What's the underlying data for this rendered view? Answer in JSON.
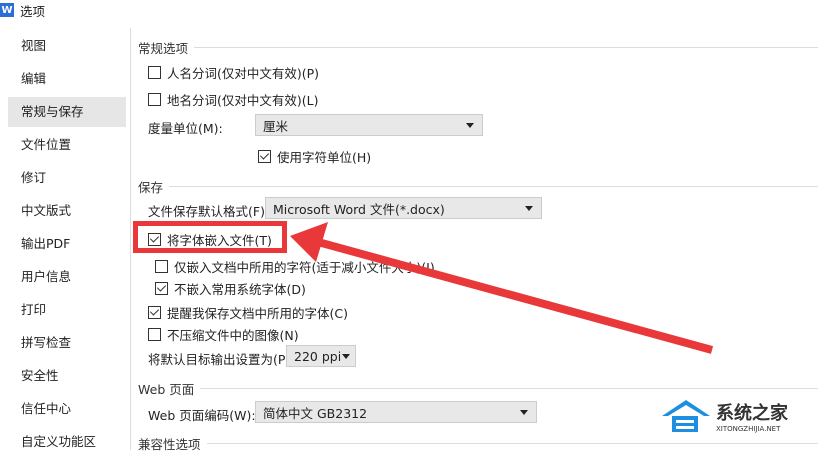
{
  "window": {
    "title": "选项",
    "app_icon": "W"
  },
  "sidebar": {
    "items": [
      {
        "label": "视图"
      },
      {
        "label": "编辑"
      },
      {
        "label": "常规与保存",
        "selected": true
      },
      {
        "label": "文件位置"
      },
      {
        "label": "修订"
      },
      {
        "label": "中文版式"
      },
      {
        "label": "输出PDF"
      },
      {
        "label": "用户信息"
      },
      {
        "label": "打印"
      },
      {
        "label": "拼写检查"
      },
      {
        "label": "安全性"
      },
      {
        "label": "信任中心"
      },
      {
        "label": "自定义功能区"
      }
    ]
  },
  "general": {
    "title": "常规选项",
    "person_name": {
      "label": "人名分词(仅对中文有效)(P)",
      "checked": false
    },
    "place_name": {
      "label": "地名分词(仅对中文有效)(L)",
      "checked": false
    },
    "unit_label": "度量单位(M):",
    "unit_value": "厘米",
    "char_unit": {
      "label": "使用字符单位(H)",
      "checked": true
    }
  },
  "save": {
    "title": "保存",
    "format_label": "文件保存默认格式(F):",
    "format_value": "Microsoft Word 文件(*.docx)",
    "embed_fonts": {
      "label": "将字体嵌入文件(T)",
      "checked": true
    },
    "embed_used_only": {
      "label": "仅嵌入文档中所用的字符(适于减小文件大小)(I)",
      "checked": false
    },
    "no_common_fonts": {
      "label": "不嵌入常用系统字体(D)",
      "checked": true
    },
    "remind_fonts": {
      "label": "提醒我保存文档中所用的字体(C)",
      "checked": true
    },
    "no_compress": {
      "label": "不压缩文件中的图像(N)",
      "checked": false
    },
    "target_label": "将默认目标输出设置为(P):",
    "target_value": "220 ppi"
  },
  "web": {
    "title": "Web 页面",
    "encoding_label": "Web 页面编码(W):",
    "encoding_value": "简体中文 GB2312"
  },
  "compat": {
    "title": "兼容性选项"
  },
  "watermark": {
    "name": "系统之家",
    "url": "XITONGZHIJIA.NET"
  },
  "colors": {
    "annotation": "#e8383a"
  }
}
